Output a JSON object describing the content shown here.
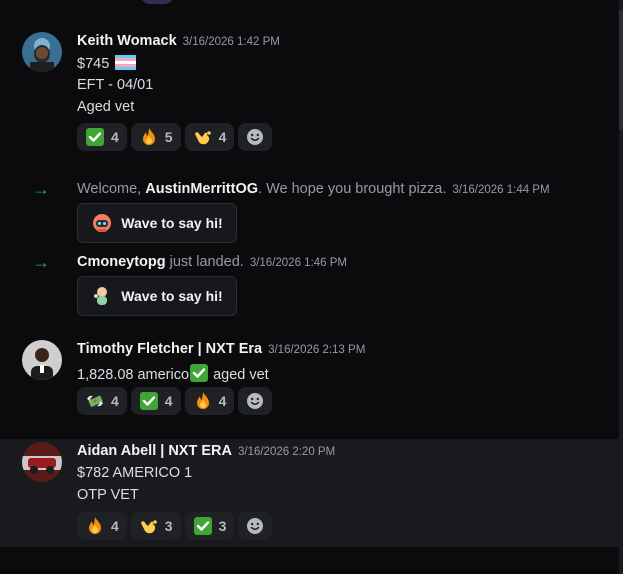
{
  "messages": [
    {
      "author": "Keith Womack",
      "timestamp": "3/16/2026 1:42 PM",
      "lines": [
        "$745",
        "EFT - 04/01",
        "Aged vet"
      ],
      "flag_icon": "transgender-flag-icon",
      "reactions": [
        {
          "icon": "check-mark-icon",
          "count": "4"
        },
        {
          "icon": "fire-icon",
          "count": "5"
        },
        {
          "icon": "call-me-hand-icon",
          "count": "4"
        }
      ]
    },
    {
      "author": "Timothy Fletcher | NXT Era",
      "timestamp": "3/16/2026 2:13 PM",
      "text_prefix": "1,828.08 americo",
      "text_suffix": " aged vet",
      "reactions": [
        {
          "icon": "money-with-wings-icon",
          "count": "4"
        },
        {
          "icon": "check-mark-icon",
          "count": "4"
        },
        {
          "icon": "fire-icon",
          "count": "4"
        }
      ]
    },
    {
      "author": "Aidan Abell | NXT ERA",
      "timestamp": "3/16/2026 2:20 PM",
      "lines": [
        "$782 AMERICO 1",
        "OTP VET"
      ],
      "reactions": [
        {
          "icon": "fire-icon",
          "count": "4"
        },
        {
          "icon": "call-me-hand-icon",
          "count": "3"
        },
        {
          "icon": "check-mark-icon",
          "count": "3"
        }
      ]
    }
  ],
  "system": [
    {
      "prefix": "Welcome, ",
      "user": "AustinMerrittOG",
      "suffix": ". We hope you brought pizza.",
      "timestamp": "3/16/2026 1:44 PM",
      "button": "Wave to say hi!"
    },
    {
      "prefix": "",
      "user": "Cmoneytopg",
      "suffix": " just landed.",
      "timestamp": "3/16/2026 1:46 PM",
      "button": "Wave to say hi!"
    }
  ],
  "colors": {
    "background": "#0b0b0d",
    "highlight_row": "#1a1a1e",
    "reaction_bg": "#202125",
    "join_arrow": "#23a55a",
    "timestamp": "#949ba4"
  }
}
